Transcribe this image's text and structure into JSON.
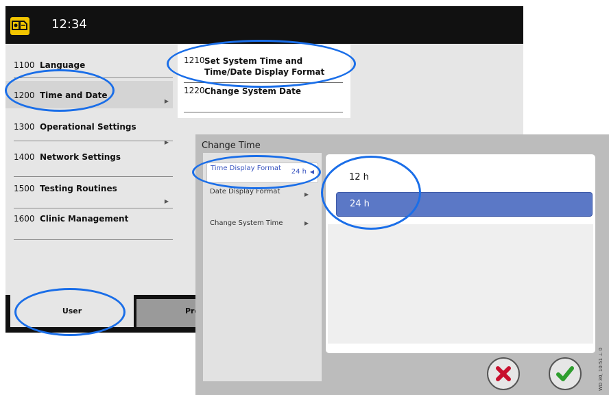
{
  "header": {
    "clock": "12:34",
    "app_icon": "device-tool-icon"
  },
  "menu": {
    "items": [
      {
        "num": "1100",
        "label": "Language"
      },
      {
        "num": "1200",
        "label": "Time and Date"
      },
      {
        "num": "1300",
        "label": "Operational Settings"
      },
      {
        "num": "1400",
        "label": "Network Settings"
      },
      {
        "num": "1500",
        "label": "Testing Routines"
      },
      {
        "num": "1600",
        "label": "Clinic Management"
      }
    ],
    "submenu": [
      {
        "num": "1210",
        "label": "Set System Time and Time/Date Display Format"
      },
      {
        "num": "1220",
        "label": "Change System Date"
      }
    ]
  },
  "tabs": {
    "user": "User",
    "programs_partial": "Prog"
  },
  "dialog": {
    "title": "Change Time",
    "options": [
      {
        "label": "Time Display Format",
        "value": "24 h"
      },
      {
        "label": "Date Display Format"
      },
      {
        "label": "Change System Time"
      }
    ],
    "time_choices": [
      "12 h",
      "24 h"
    ],
    "selected_choice": "24 h",
    "cancel_icon": "close-x-icon",
    "ok_icon": "check-icon"
  },
  "side_code": "WD 30, 10:51 ⊥ 0"
}
